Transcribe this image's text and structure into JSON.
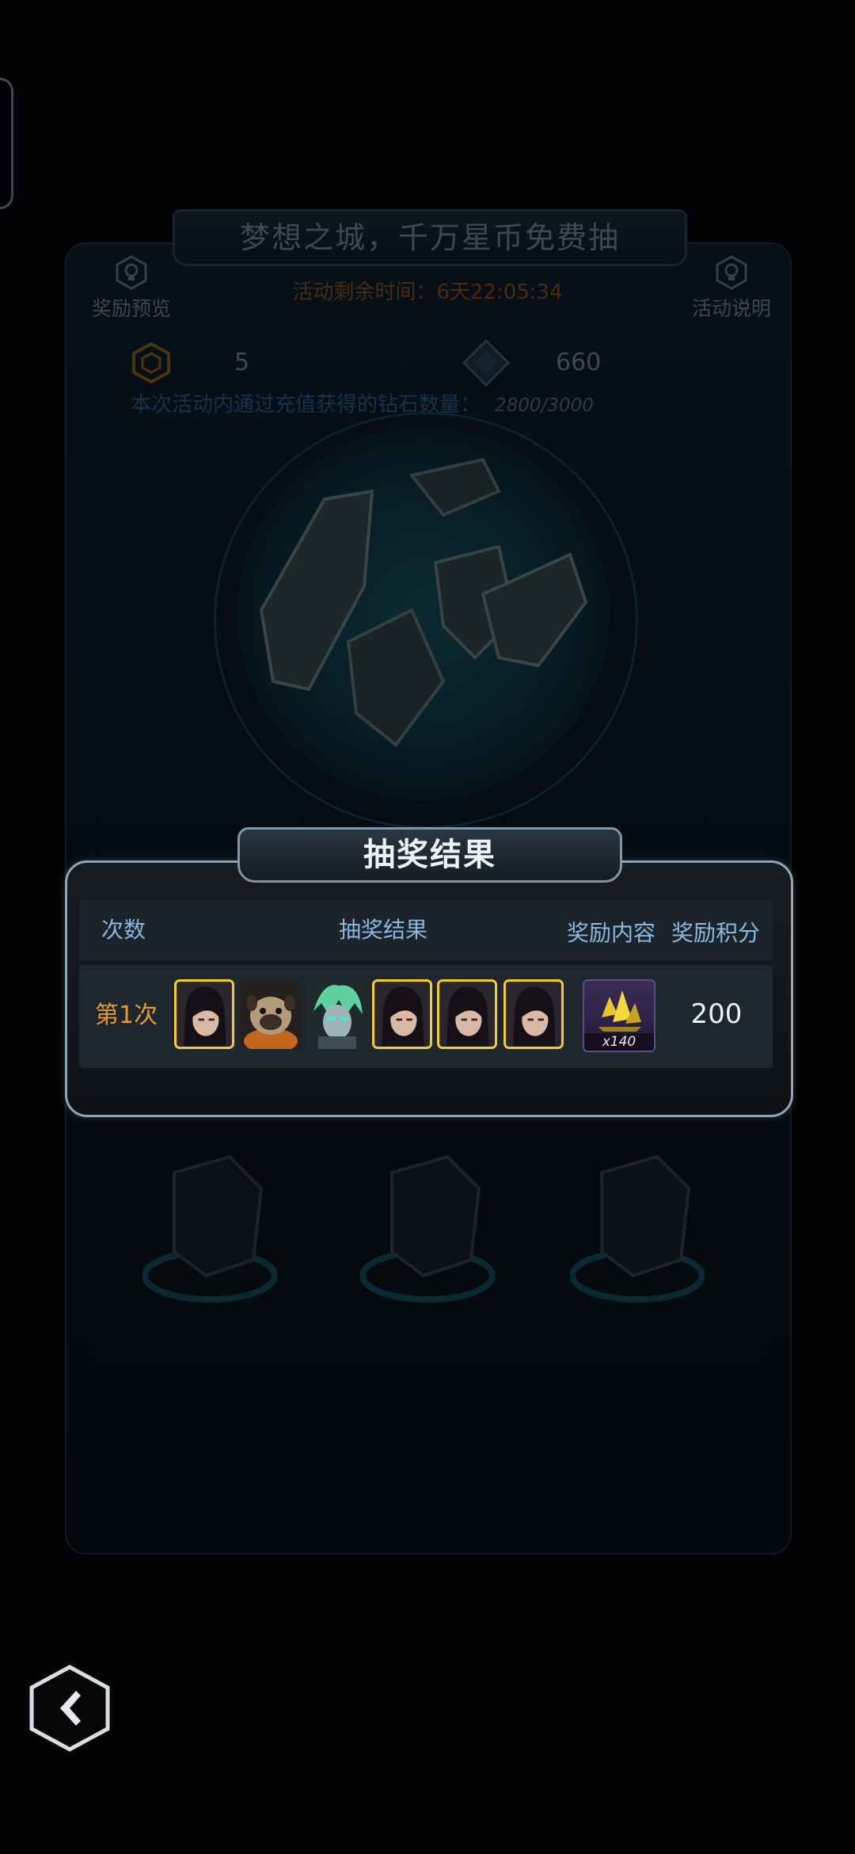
{
  "event": {
    "title": "梦想之城，千万星币免费抽",
    "timer": "活动剩余时间：6天22:05:34",
    "reward_preview_label": "奖励预览",
    "event_info_label": "活动说明",
    "token_count": "5",
    "diamond_count": "660",
    "recharge_note": "本次活动内通过充值获得的钻石数量：",
    "recharge_progress": "2800/3000"
  },
  "result_dialog": {
    "title": "抽奖结果",
    "headers": {
      "count": "次数",
      "result": "抽奖结果",
      "reward": "奖励内容",
      "points": "奖励积分"
    },
    "rows": [
      {
        "count_label": "第1次",
        "draws": [
          {
            "character": "black-haired-girl",
            "gold_border": true
          },
          {
            "character": "pug-dog",
            "gold_border": false
          },
          {
            "character": "green-haired-robot",
            "gold_border": false
          },
          {
            "character": "black-haired-girl",
            "gold_border": true
          },
          {
            "character": "black-haired-girl",
            "gold_border": true
          },
          {
            "character": "black-haired-girl",
            "gold_border": true
          }
        ],
        "reward_icon": "gold-crystal-icon",
        "reward_qty": "x140",
        "points": "200"
      }
    ]
  },
  "colors": {
    "accent_gold": "#f5cc2c",
    "count_orange": "#e39a35",
    "header_blue": "#88b8e0",
    "panel_border": "#8fa5b4"
  }
}
